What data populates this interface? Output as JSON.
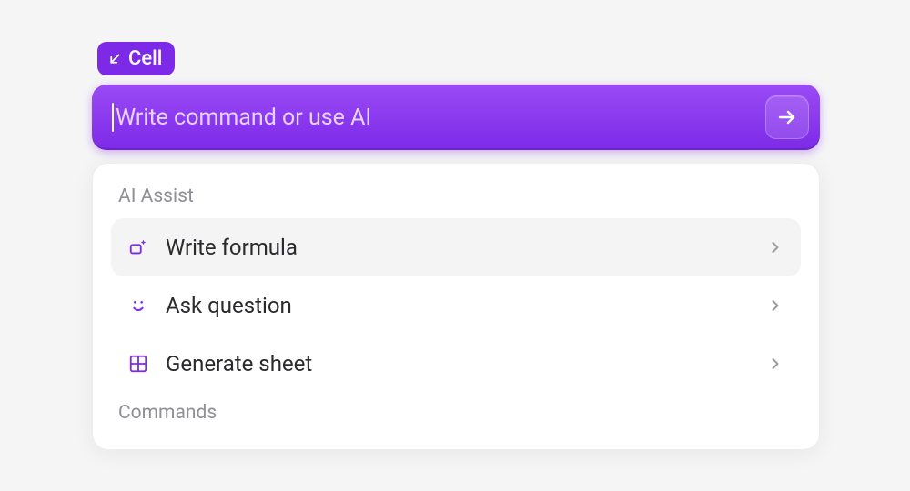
{
  "scope": {
    "label": "Cell"
  },
  "command_bar": {
    "placeholder": "Write command or use AI",
    "value": ""
  },
  "sections": {
    "ai_assist": {
      "title": "AI Assist",
      "items": [
        {
          "label": "Write formula",
          "icon": "sparkle-box-icon",
          "highlighted": true
        },
        {
          "label": "Ask question",
          "icon": "face-icon",
          "highlighted": false
        },
        {
          "label": "Generate sheet",
          "icon": "grid-icon",
          "highlighted": false
        }
      ]
    },
    "commands": {
      "title": "Commands"
    }
  },
  "colors": {
    "accent": "#7c2ae8",
    "accent_light": "#9b4af5",
    "panel_bg": "#ffffff",
    "page_bg": "#f5f5f6"
  }
}
